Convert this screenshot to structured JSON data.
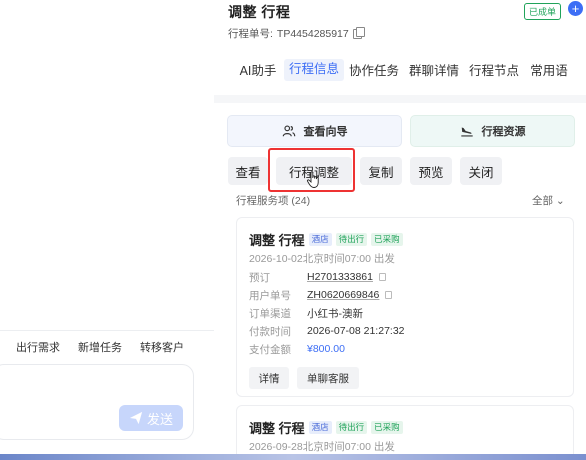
{
  "left": {
    "actions": [
      "出行需求",
      "新增任务",
      "转移客户"
    ],
    "send_label": "发送"
  },
  "header": {
    "title": "调整 行程",
    "order_label": "行程单号:",
    "order_no": "TP4454285917",
    "status": "已成单",
    "plus": "+"
  },
  "tabs": [
    "AI助手",
    "行程信息",
    "协作任务",
    "群聊详情",
    "行程节点",
    "常用语"
  ],
  "big_buttons": {
    "guide": "查看向导",
    "resource": "行程资源"
  },
  "actions": [
    "查看",
    "行程调整",
    "复制",
    "预览",
    "关闭"
  ],
  "services": {
    "heading": "行程服务项 (24)",
    "filter": "全部 ⌄"
  },
  "cards": [
    {
      "title": "调整 行程",
      "tags": [
        "酒店",
        "待出行",
        "已采购"
      ],
      "date": "2026-10-02北京时间07:00 出发",
      "rows": [
        {
          "k": "预订",
          "v": "H2701333861"
        },
        {
          "k": "用户单号",
          "v": "ZH0620669846"
        },
        {
          "k": "订单渠道",
          "v": "小红书-澳新"
        },
        {
          "k": "付款时间",
          "v": "2026-07-08 21:27:32"
        },
        {
          "k": "支付金额",
          "v": "¥800.00"
        }
      ],
      "buttons": [
        "详情",
        "单聊客服"
      ]
    },
    {
      "title": "调整 行程",
      "tags": [
        "酒店",
        "待出行",
        "已采购"
      ],
      "date": "2026-09-28北京时间07:00 出发"
    }
  ],
  "colors": {
    "accent": "#3d6ef5",
    "success": "#20a35a",
    "highlight": "#e33333"
  }
}
